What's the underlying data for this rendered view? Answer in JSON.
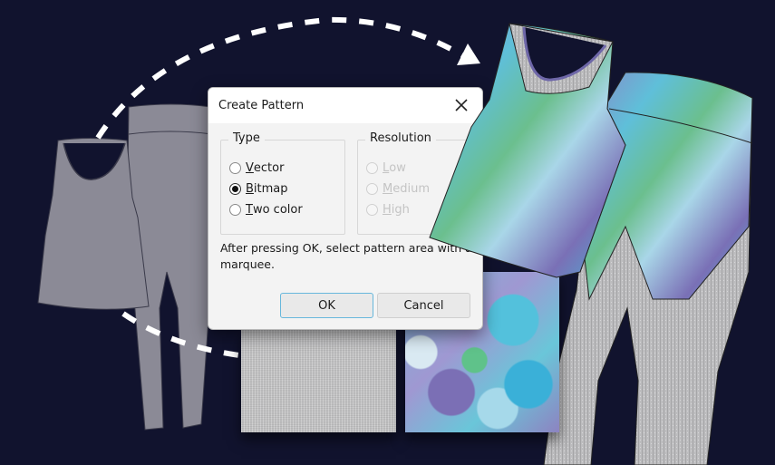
{
  "dialog": {
    "title": "Create Pattern",
    "close_icon": "close-icon",
    "type_group": {
      "legend": "Type",
      "options": [
        {
          "label_ul": "V",
          "label_rest": "ector",
          "checked": false
        },
        {
          "label_ul": "B",
          "label_rest": "itmap",
          "checked": true
        },
        {
          "label_ul": "T",
          "label_rest": "wo color",
          "checked": false
        }
      ]
    },
    "resolution_group": {
      "legend": "Resolution",
      "options": [
        {
          "label_ul": "L",
          "label_rest": "ow",
          "disabled": true
        },
        {
          "label_ul": "M",
          "label_rest": "edium",
          "disabled": true
        },
        {
          "label_ul": "H",
          "label_rest": "igh",
          "disabled": true
        }
      ]
    },
    "info_text": "After pressing OK, select pattern area with a marquee.",
    "ok_label": "OK",
    "cancel_label": "Cancel"
  },
  "artwork": {
    "background_color": "#11132e",
    "garment_gray": "#8b8a96",
    "arrow_color": "#ffffff",
    "left_items": [
      "tank-top-sketch",
      "leggings-sketch"
    ],
    "right_items": [
      "printed-tank-top",
      "printed-leggings"
    ],
    "swatches": [
      "heather-gray-fabric-swatch",
      "floral-print-fabric-swatch"
    ]
  }
}
